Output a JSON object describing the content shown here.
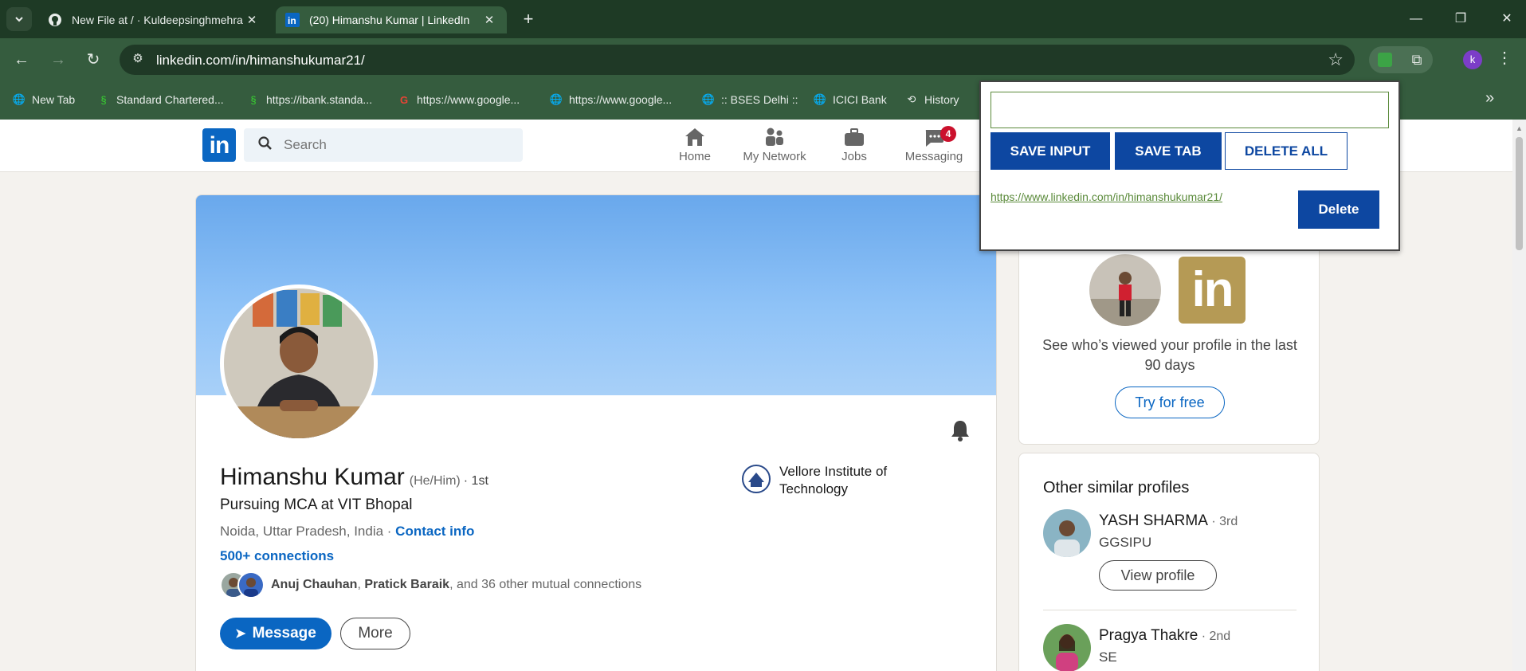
{
  "browser": {
    "tabs": [
      {
        "title": "New File at / · Kuldeepsinghmehra",
        "favicon": "github-icon",
        "active": false
      },
      {
        "title": "(20) Himanshu Kumar | LinkedIn",
        "favicon": "linkedin-icon",
        "active": true
      }
    ],
    "url": "linkedin.com/in/himanshukumar21/",
    "profile_initial": "k",
    "bookmarks": [
      {
        "label": "New Tab",
        "icon": "globe-icon"
      },
      {
        "label": "Standard Chartered...",
        "icon": "standard-chartered-icon"
      },
      {
        "label": "https://ibank.standa...",
        "icon": "standard-chartered-icon"
      },
      {
        "label": "https://www.google...",
        "icon": "google-icon"
      },
      {
        "label": "https://www.google...",
        "icon": "globe-icon"
      },
      {
        "label": ":: BSES Delhi ::",
        "icon": "globe-icon"
      },
      {
        "label": "ICICI Bank",
        "icon": "globe-icon"
      },
      {
        "label": "History",
        "icon": "history-icon"
      }
    ]
  },
  "linkedin": {
    "search_placeholder": "Search",
    "nav": [
      {
        "label": "Home",
        "icon": "home-icon"
      },
      {
        "label": "My Network",
        "icon": "network-icon"
      },
      {
        "label": "Jobs",
        "icon": "briefcase-icon"
      },
      {
        "label": "Messaging",
        "icon": "messaging-icon",
        "badge": "4"
      }
    ],
    "profile": {
      "name": "Himanshu Kumar",
      "pronouns": "(He/Him)",
      "degree": "· 1st",
      "headline": "Pursuing MCA at VIT Bhopal",
      "location": "Noida, Uttar Pradesh, India",
      "separator": " · ",
      "contact_info": "Contact info",
      "connections": "500+ connections",
      "mutual_name1": "Anuj Chauhan",
      "mutual_sep": ", ",
      "mutual_name2": "Pratick Baraik",
      "mutual_rest": ", and 36 other mutual connections",
      "message_label": "Message",
      "more_label": "More",
      "school": "Vellore Institute of Technology"
    },
    "sidebar": {
      "views_text": "See who’s viewed your profile in the last 90 days",
      "try_label": "Try for free",
      "similar_title": "Other similar profiles",
      "similar": [
        {
          "name": "YASH SHARMA",
          "degree": " · 3rd",
          "subtitle": "GGSIPU",
          "button": "View profile"
        },
        {
          "name": "Pragya Thakre",
          "degree": " · 2nd",
          "subtitle": "SE"
        }
      ]
    }
  },
  "popup": {
    "input_value": "",
    "save_input": "SAVE INPUT",
    "save_tab": "SAVE TAB",
    "delete_all": "DELETE ALL",
    "saved_link": "https://www.linkedin.com/in/himanshukumar21/",
    "delete": "Delete"
  },
  "colors": {
    "chrome_dark": "#1e3a25",
    "chrome": "#355c3e",
    "linkedin_blue": "#0a66c2",
    "popup_blue": "#0d47a1",
    "link_green": "#5a8a3a"
  }
}
